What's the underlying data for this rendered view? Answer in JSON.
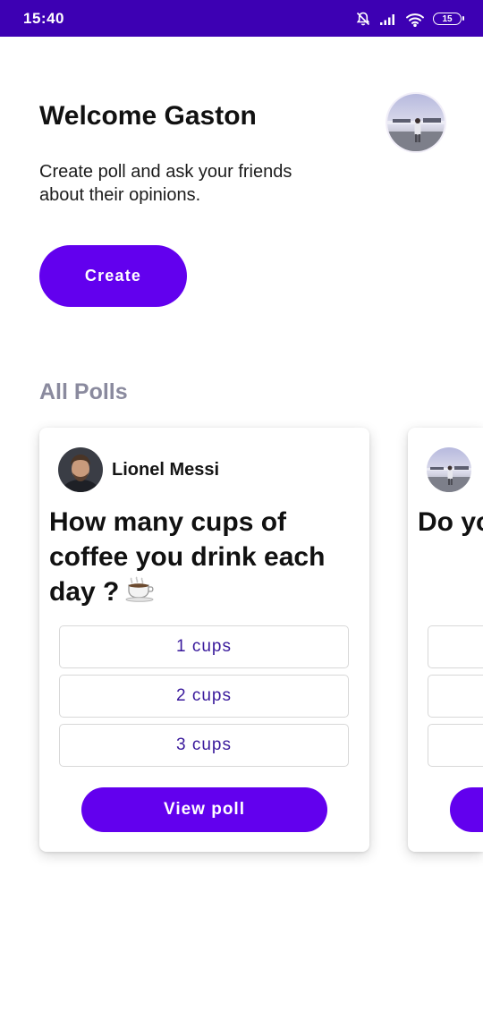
{
  "status_bar": {
    "time": "15:40",
    "battery": "15",
    "icons": [
      "bell-off-icon",
      "signal-icon",
      "wifi-icon",
      "battery-icon"
    ]
  },
  "header": {
    "welcome": "Welcome Gaston",
    "subtitle": "Create poll and ask your friends about their opinions.",
    "create_label": "Create"
  },
  "section": {
    "title": "All Polls"
  },
  "polls": [
    {
      "author": "Lionel Messi",
      "question": "How many cups of coffee you drink each day ?",
      "question_icon": "coffee-icon",
      "options": [
        "1 cups",
        "2 cups",
        "3 cups"
      ],
      "view_label": "View poll"
    },
    {
      "author": "",
      "question": "Do yo",
      "options": [
        "",
        "",
        ""
      ],
      "view_label": ""
    }
  ],
  "colors": {
    "status_bar": "#3d00b3",
    "primary": "#6200ee",
    "section_title": "#8a8a9e",
    "option_text": "#3a1a9c"
  }
}
